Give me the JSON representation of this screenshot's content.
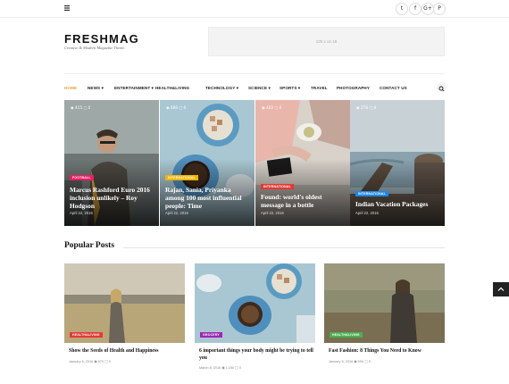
{
  "topbar": {
    "social": [
      "t",
      "f",
      "G+",
      "P"
    ]
  },
  "header": {
    "logo": "FRESHMAG",
    "tagline": "Creative & Modern Magazine Theme",
    "ad_text": "125 x on 18"
  },
  "nav": {
    "items": [
      "HOME",
      "NEWS",
      "ENTERTAINMENT",
      "HEALTH&LIVING",
      "TECHNOLOGY",
      "SCIENCE",
      "SPORTS",
      "TRAVEL",
      "PHOTOGRAPHY",
      "CONTACT US"
    ],
    "dropdown_marker": "▾"
  },
  "features": [
    {
      "views": "415",
      "comments": "0",
      "category": "FOOTBALL",
      "category_color": "#e91e63",
      "title": "Marcus Rashford Euro 2016 inclusion unlikely – Roy Hodgson",
      "date": "April 22, 2016"
    },
    {
      "views": "480",
      "comments": "0",
      "category": "INTERNATIONAL",
      "category_color": "#f0b400",
      "title": "Rajan, Sania, Priyanka among 100 most influential people: Time",
      "date": "April 22, 2016"
    },
    {
      "views": "402",
      "comments": "0",
      "category": "INTERNATIONAL",
      "category_color": "#e53935",
      "title": "Found: world's oldest message in a bottle",
      "date": "April 22, 2016"
    },
    {
      "views": "278",
      "comments": "0",
      "category": "INTERNATIONAL",
      "category_color": "#1e88e5",
      "title": "Indian Vacation Packages",
      "date": "April 22, 2016"
    }
  ],
  "popular": {
    "title": "Popular Posts",
    "posts": [
      {
        "category": "HEALTH&LIVING",
        "category_color": "#e53935",
        "title": "Show the Seeds of Health and Happiness",
        "date": "January 6, 2016",
        "views": "870",
        "comments": "0"
      },
      {
        "category": "GROCERY",
        "category_color": "#9c27b0",
        "title": "6 important things your body might be trying to tell you",
        "date": "March 8, 2016",
        "views": "1,150",
        "comments": "0"
      },
      {
        "category": "HEALTH&LIVING",
        "category_color": "#4caf50",
        "title": "Fast Fashion: 8 Things You Need to Know",
        "date": "January 6, 2016",
        "views": "590",
        "comments": "0"
      }
    ]
  }
}
